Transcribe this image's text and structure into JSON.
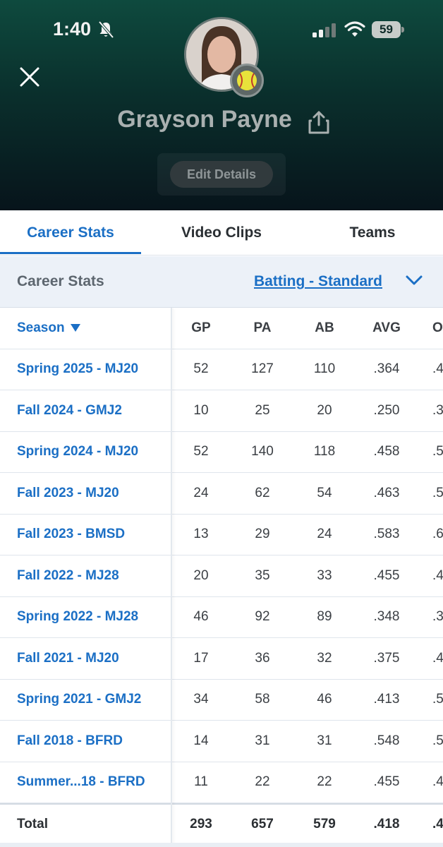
{
  "status_bar": {
    "time": "1:40",
    "battery": "59"
  },
  "profile": {
    "name": "Grayson Payne",
    "edit_label": "Edit Details"
  },
  "tabs": [
    {
      "label": "Career Stats",
      "active": true
    },
    {
      "label": "Video Clips",
      "active": false
    },
    {
      "label": "Teams",
      "active": false
    }
  ],
  "filter": {
    "label": "Career Stats",
    "selected": "Batting - Standard"
  },
  "table": {
    "columns": [
      "Season",
      "GP",
      "PA",
      "AB",
      "AVG",
      "O"
    ],
    "rows": [
      [
        "Spring 2025 - MJ20",
        "52",
        "127",
        "110",
        ".364",
        ".4"
      ],
      [
        "Fall 2024 - GMJ2",
        "10",
        "25",
        "20",
        ".250",
        ".3"
      ],
      [
        "Spring 2024 - MJ20",
        "52",
        "140",
        "118",
        ".458",
        ".5"
      ],
      [
        "Fall 2023 - MJ20",
        "24",
        "62",
        "54",
        ".463",
        ".5"
      ],
      [
        "Fall 2023 - BMSD",
        "13",
        "29",
        "24",
        ".583",
        ".6"
      ],
      [
        "Fall 2022 - MJ28",
        "20",
        "35",
        "33",
        ".455",
        ".4"
      ],
      [
        "Spring 2022 - MJ28",
        "46",
        "92",
        "89",
        ".348",
        ".3"
      ],
      [
        "Fall 2021 - MJ20",
        "17",
        "36",
        "32",
        ".375",
        ".4"
      ],
      [
        "Spring 2021 - GMJ2",
        "34",
        "58",
        "46",
        ".413",
        ".5"
      ],
      [
        "Fall 2018 - BFRD",
        "14",
        "31",
        "31",
        ".548",
        ".5"
      ],
      [
        "Summer...18 - BFRD",
        "11",
        "22",
        "22",
        ".455",
        ".4"
      ]
    ],
    "total": [
      "Total",
      "293",
      "657",
      "579",
      ".418",
      ".4"
    ]
  },
  "colors": {
    "accent": "#1b6fc5",
    "header_top": "#0e4a3e",
    "header_bottom": "#07141b"
  }
}
